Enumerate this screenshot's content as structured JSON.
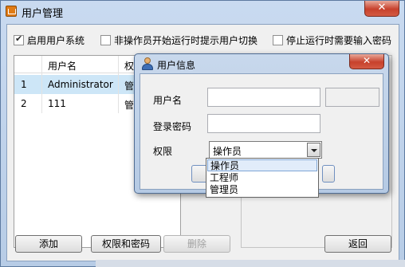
{
  "window": {
    "title": "用户管理",
    "close_label": "✕"
  },
  "options": [
    {
      "label": "启用用户系统",
      "checked": true
    },
    {
      "label": "非操作员开始运行时提示用户切换",
      "checked": false
    },
    {
      "label": "停止运行时需要输入密码",
      "checked": false
    }
  ],
  "user_list": {
    "columns": [
      "用户名",
      "权"
    ],
    "rows": [
      {
        "index": "1",
        "name": "Administrator",
        "perm": "管",
        "selected": true
      },
      {
        "index": "2",
        "name": "111",
        "perm": "管",
        "selected": false
      }
    ]
  },
  "buttons": {
    "add": "添加",
    "perm_pwd": "权限和密码",
    "delete": "删除",
    "back": "返回"
  },
  "dialog": {
    "title": "用户信息",
    "close_label": "✕",
    "username_label": "用户名",
    "password_label": "登录密码",
    "permission_label": "权限",
    "username_value": "",
    "password_value": "",
    "permission_value": "操作员",
    "permission_options": [
      "操作员",
      "工程师",
      "管理员"
    ]
  }
}
